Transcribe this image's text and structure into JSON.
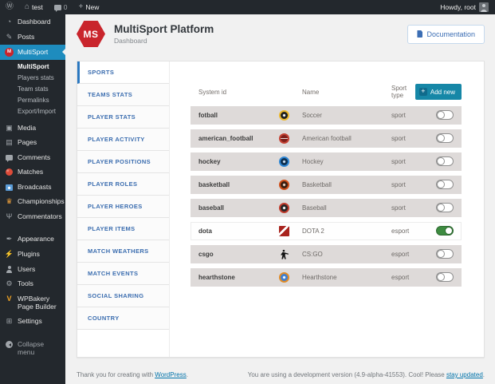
{
  "admin_bar": {
    "site_name": "test",
    "comments_count": "0",
    "new_label": "New",
    "howdy": "Howdy, root",
    "icons": [
      "wordpress-logo-icon",
      "home-icon",
      "comments-bubble-icon",
      "plus-icon",
      "avatar"
    ]
  },
  "sidebar": {
    "items": [
      {
        "label": "Dashboard",
        "icon": "dashboard-icon"
      },
      {
        "label": "Posts",
        "icon": "posts-icon"
      },
      {
        "label": "MultiSport",
        "icon": "multisport-logo-icon",
        "active": true,
        "submenu": [
          {
            "label": "MultiSport",
            "active": true
          },
          {
            "label": "Players stats"
          },
          {
            "label": "Team stats"
          },
          {
            "label": "Permalinks"
          },
          {
            "label": "Export/Import"
          }
        ]
      },
      {
        "label": "Media",
        "icon": "media-icon"
      },
      {
        "label": "Pages",
        "icon": "pages-icon"
      },
      {
        "label": "Comments",
        "icon": "comments-icon"
      },
      {
        "label": "Matches",
        "icon": "matches-icon"
      },
      {
        "label": "Broadcasts",
        "icon": "broadcasts-icon"
      },
      {
        "label": "Championships",
        "icon": "championships-icon"
      },
      {
        "label": "Commentators",
        "icon": "commentators-icon"
      },
      {
        "separator": true
      },
      {
        "label": "Appearance",
        "icon": "appearance-icon"
      },
      {
        "label": "Plugins",
        "icon": "plugins-icon"
      },
      {
        "label": "Users",
        "icon": "users-icon"
      },
      {
        "label": "Tools",
        "icon": "tools-icon"
      },
      {
        "label": "WPBakery Page Builder",
        "icon": "wpbakery-icon"
      },
      {
        "label": "Settings",
        "icon": "settings-icon"
      },
      {
        "separator": true
      },
      {
        "label": "Collapse menu",
        "icon": "collapse-icon",
        "muted": true
      }
    ]
  },
  "header": {
    "title": "MultiSport Platform",
    "subtitle": "Dashboard",
    "logo_text": "MS",
    "documentation_label": "Documentation"
  },
  "tabs": [
    {
      "label": "SPORTS",
      "active": true
    },
    {
      "label": "TEAMS STATS"
    },
    {
      "label": "PLAYER STATS"
    },
    {
      "label": "PLAYER ACTIVITY"
    },
    {
      "label": "PLAYER POSITIONS"
    },
    {
      "label": "PLAYER ROLES"
    },
    {
      "label": "PLAYER HEROES"
    },
    {
      "label": "PLAYER ITEMS"
    },
    {
      "label": "MATCH WEATHERS"
    },
    {
      "label": "MATCH EVENTS"
    },
    {
      "label": "SOCIAL SHARING"
    },
    {
      "label": "COUNTRY"
    }
  ],
  "table": {
    "columns": [
      "System id",
      "Name",
      "Sport type"
    ],
    "add_new_label": "Add new",
    "rows": [
      {
        "id": "fotball",
        "icon": "soccer-ball-icon",
        "name": "Soccer",
        "type": "sport",
        "enabled": false
      },
      {
        "id": "american_football",
        "icon": "american-football-icon",
        "name": "American football",
        "type": "sport",
        "enabled": false
      },
      {
        "id": "hockey",
        "icon": "hockey-puck-icon",
        "name": "Hockey",
        "type": "sport",
        "enabled": false
      },
      {
        "id": "basketball",
        "icon": "basketball-icon",
        "name": "Basketball",
        "type": "sport",
        "enabled": false
      },
      {
        "id": "baseball",
        "icon": "baseball-icon",
        "name": "Baseball",
        "type": "sport",
        "enabled": false
      },
      {
        "id": "dota",
        "icon": "dota2-icon",
        "name": "DOTA 2",
        "type": "esport",
        "enabled": true
      },
      {
        "id": "csgo",
        "icon": "csgo-icon",
        "name": "CS:GO",
        "type": "esport",
        "enabled": false
      },
      {
        "id": "hearthstone",
        "icon": "hearthstone-icon",
        "name": "Hearthstone",
        "type": "esport",
        "enabled": false
      }
    ]
  },
  "footer": {
    "left_prefix": "Thank you for creating with ",
    "left_link": "WordPress",
    "left_suffix": ".",
    "right_prefix": "You are using a development version (4.9-alpha-41553). Cool! Please ",
    "right_link": "stay updated",
    "right_suffix": ".",
    "colors": {
      "accent": "#1e8cbe",
      "add_new": "#1687a7",
      "toggle_on": "#3d8b40",
      "logo_red": "#c9252c"
    }
  }
}
